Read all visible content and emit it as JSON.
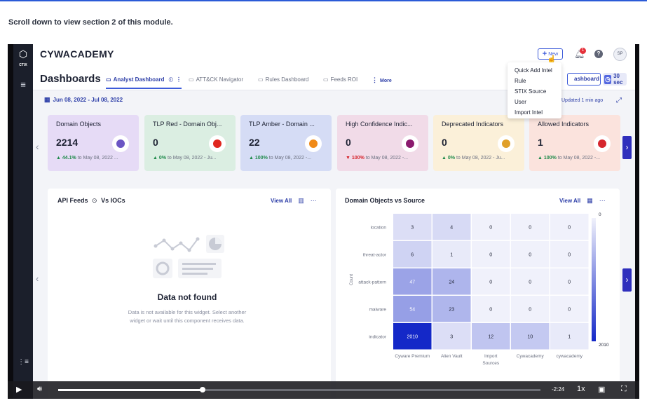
{
  "instruction": "Scroll down to view section 2 of this module.",
  "app": {
    "brand": "CYWACADEMY",
    "sidebar_logo_text": "CTIX",
    "new_button": "New",
    "notification_count": "1",
    "user_initials": "SP"
  },
  "new_menu": [
    "Quick Add Intel",
    "Rule",
    "STIX Source",
    "User",
    "Import Intel"
  ],
  "dashboard": {
    "title": "Dashboards",
    "tabs": [
      {
        "label": "Analyst Dashboard",
        "active": true
      },
      {
        "label": "ATT&CK Navigator",
        "active": false
      },
      {
        "label": "Rules Dashboard",
        "active": false
      },
      {
        "label": "Feeds ROI",
        "active": false
      }
    ],
    "more": "More",
    "dashboard_button": "ashboard",
    "refresh": "30 sec",
    "date_range": "Jun 08, 2022 - Jul 08, 2022",
    "updated": "Updated 1 min ago"
  },
  "cards": [
    {
      "title": "Domain Objects",
      "value": "2214",
      "change": "44.1%",
      "direction": "up",
      "suffix": "to May 08, 2022 ...",
      "bg": "#e6dbf6",
      "icon_color": "#6b55c4"
    },
    {
      "title": "TLP Red - Domain Obj...",
      "value": "0",
      "change": "0%",
      "direction": "up",
      "suffix": "to May 08, 2022 - Ju...",
      "bg": "#dbeee2",
      "icon_color": "#e0271f"
    },
    {
      "title": "TLP Amber - Domain ...",
      "value": "22",
      "change": "100%",
      "direction": "up",
      "suffix": "to May 08, 2022 -...",
      "bg": "#d5dcf5",
      "icon_color": "#f08a17"
    },
    {
      "title": "High Confidence Indic...",
      "value": "0",
      "change": "100%",
      "direction": "down",
      "suffix": "to May 08, 2022 -...",
      "bg": "#f1dbe8",
      "icon_color": "#8b1a6e"
    },
    {
      "title": "Deprecated Indicators",
      "value": "0",
      "change": "0%",
      "direction": "up",
      "suffix": "to May 08, 2022 - Ju...",
      "bg": "#fbf0d9",
      "icon_color": "#e0a02a"
    },
    {
      "title": "Allowed Indicators",
      "value": "1",
      "change": "100%",
      "direction": "up",
      "suffix": "to May 08, 2022 -...",
      "bg": "#fbe3dd",
      "icon_color": "#d6262e"
    }
  ],
  "panel_left": {
    "title_a": "API Feeds",
    "title_b": "Vs IOCs",
    "view_all": "View All",
    "empty_title": "Data not found",
    "empty_desc": "Data is not available for this widget. Select another widget or wait until this component receives data."
  },
  "panel_right": {
    "title": "Domain Objects vs Source",
    "view_all": "View All"
  },
  "chart_data": {
    "type": "heatmap",
    "title": "Domain Objects vs Source",
    "ylabel": "Count",
    "rows": [
      "location",
      "threat-actor",
      "attack-pattern",
      "malware",
      "indicator"
    ],
    "columns": [
      "Cyware Premium",
      "Alien Vault",
      "Import Sources",
      "Cywacademy",
      "cywacademy"
    ],
    "values": [
      [
        3,
        4,
        0,
        0,
        0
      ],
      [
        6,
        1,
        0,
        0,
        0
      ],
      [
        47,
        24,
        0,
        0,
        0
      ],
      [
        54,
        23,
        0,
        0,
        0
      ],
      [
        2010,
        3,
        12,
        10,
        1
      ]
    ],
    "scale_min": 0,
    "scale_max": 2010,
    "colors": {
      "low": "#f0f1fb",
      "high": "#1428c8"
    }
  },
  "player": {
    "time_remaining": "-2:24",
    "speed": "1x",
    "progress": 0.3
  }
}
